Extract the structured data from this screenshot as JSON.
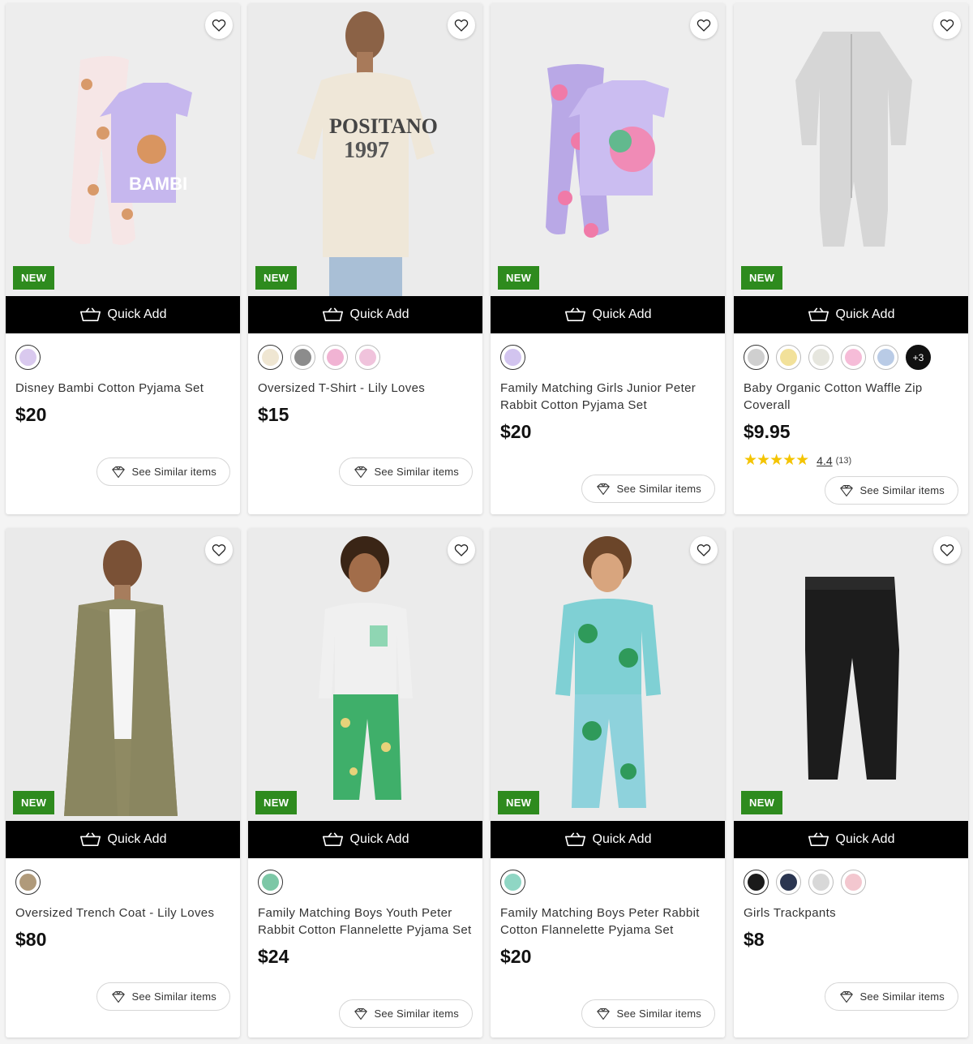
{
  "theme": {
    "accent_new": "#2e8b1e",
    "quick_add_bg": "#000000",
    "star_color": "#f4c400"
  },
  "products": [
    {
      "name": "Disney Bambi Cotton Pyjama Set",
      "price": "$20",
      "badge": "NEW",
      "quick_add_label": "Quick Add",
      "similar_label": "See Similar items",
      "swatches": [
        "#d9c9ee"
      ],
      "more": "",
      "rating": null,
      "image": "bambi-pyjama-set"
    },
    {
      "name": "Oversized T-Shirt - Lily Loves",
      "price": "$15",
      "badge": "NEW",
      "quick_add_label": "Quick Add",
      "similar_label": "See Similar items",
      "swatches": [
        "#efe6d2",
        "#8c8c8c",
        "#f1b3d3",
        "#f0c3dc"
      ],
      "more": "",
      "rating": null,
      "image": "oversized-tshirt"
    },
    {
      "name": "Family Matching Girls Junior Peter Rabbit Cotton Pyjama Set",
      "price": "$20",
      "badge": "NEW",
      "quick_add_label": "Quick Add",
      "similar_label": "See Similar items",
      "swatches": [
        "#d2c4ef"
      ],
      "more": "",
      "rating": null,
      "image": "peter-rabbit-girls-pyjama"
    },
    {
      "name": "Baby Organic Cotton Waffle Zip Coverall",
      "price": "$9.95",
      "badge": "NEW",
      "quick_add_label": "Quick Add",
      "similar_label": "See Similar items",
      "swatches": [
        "#cfcfcf",
        "#f2e19a",
        "#e6e6de",
        "#f6bcd8",
        "#b9cbe6"
      ],
      "more": "+3",
      "rating": {
        "stars": "★★★★★",
        "value": "4.4",
        "count": "(13)"
      },
      "image": "baby-waffle-coverall"
    },
    {
      "name": "Oversized Trench Coat - Lily Loves",
      "price": "$80",
      "badge": "NEW",
      "quick_add_label": "Quick Add",
      "similar_label": "See Similar items",
      "swatches": [
        "#b09a7a"
      ],
      "more": "",
      "rating": null,
      "image": "trench-coat"
    },
    {
      "name": "Family Matching Boys Youth Peter Rabbit Cotton Flannelette Pyjama Set",
      "price": "$24",
      "badge": "NEW",
      "quick_add_label": "Quick Add",
      "similar_label": "See Similar items",
      "swatches": [
        "#7cc7a6"
      ],
      "more": "",
      "rating": null,
      "image": "boys-youth-pyjama"
    },
    {
      "name": "Family Matching Boys Peter Rabbit Cotton Flannelette Pyjama Set",
      "price": "$20",
      "badge": "NEW",
      "quick_add_label": "Quick Add",
      "similar_label": "See Similar items",
      "swatches": [
        "#8fd6c4"
      ],
      "more": "",
      "rating": null,
      "image": "boys-pyjama"
    },
    {
      "name": "Girls Trackpants",
      "price": "$8",
      "badge": "NEW",
      "quick_add_label": "Quick Add",
      "similar_label": "See Similar items",
      "swatches": [
        "#1a1a1a",
        "#2a3550",
        "#d8d8d8",
        "#f3c7cf"
      ],
      "more": "",
      "rating": null,
      "image": "girls-trackpants"
    }
  ]
}
